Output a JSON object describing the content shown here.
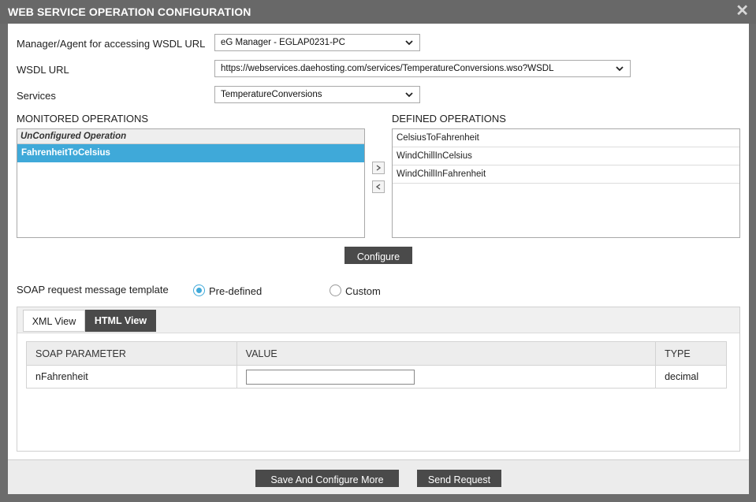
{
  "dialog": {
    "title": "WEB SERVICE OPERATION CONFIGURATION",
    "close_symbol": "✕"
  },
  "form": {
    "manager_label": "Manager/Agent for accessing WSDL URL",
    "manager_value": "eG Manager - EGLAP0231-PC",
    "wsdl_label": "WSDL URL",
    "wsdl_value": "https://webservices.daehosting.com/services/TemperatureConversions.wso?WSDL",
    "services_label": "Services",
    "services_value": "TemperatureConversions"
  },
  "monitored": {
    "heading": "MONITORED OPERATIONS",
    "list_header": "UnConfigured Operation",
    "items": [
      "FahrenheitToCelsius"
    ]
  },
  "defined": {
    "heading": "DEFINED OPERATIONS",
    "items": [
      "CelsiusToFahrenheit",
      "WindChillInCelsius",
      "WindChillInFahrenheit"
    ]
  },
  "configure_label": "Configure",
  "soap": {
    "template_label": "SOAP request message template",
    "option_predefined": "Pre-defined",
    "option_custom": "Custom",
    "selected": "Pre-defined"
  },
  "tabs": {
    "xml": "XML View",
    "html": "HTML View",
    "active": "HTML View"
  },
  "table": {
    "headers": [
      "SOAP PARAMETER",
      "VALUE",
      "TYPE"
    ],
    "rows": [
      {
        "parameter": "nFahrenheit",
        "value": "",
        "type": "decimal"
      }
    ]
  },
  "footer": {
    "save_label": "Save And Configure More",
    "send_label": "Send Request"
  },
  "colors": {
    "accent": "#3fa9d9",
    "dark_button": "#4a4a4a",
    "title_bar": "#686868"
  },
  "icons": {
    "move_right": "chevron-right-icon",
    "move_left": "chevron-left-icon",
    "dropdown": "chevron-down-icon",
    "close": "close-icon"
  }
}
